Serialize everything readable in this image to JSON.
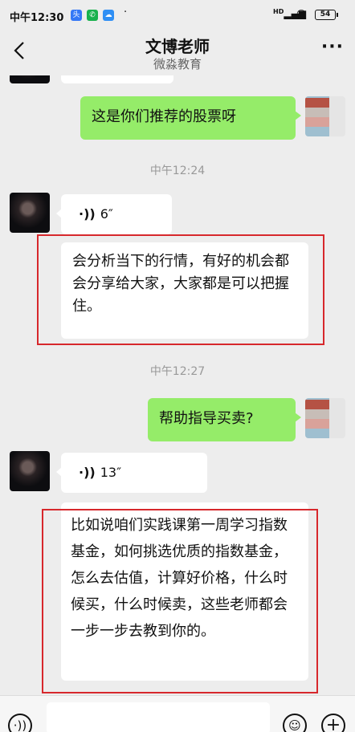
{
  "status_bar": {
    "time": "中午12:30",
    "app_icons": [
      {
        "icon": "toutiao-app-icon",
        "glyph": "头",
        "color": "#3478f6"
      },
      {
        "icon": "phone-app-icon",
        "glyph": "✆",
        "color": "#18b14d"
      },
      {
        "icon": "cloud-app-icon",
        "glyph": "☁",
        "color": "#2f8ff5"
      }
    ],
    "dot": "·",
    "signal": "HD",
    "battery": "54"
  },
  "header": {
    "back_icon": "back-chevron-icon",
    "title": "文博老师",
    "subtitle": "微淼教育",
    "more_label": "···"
  },
  "messages": {
    "m1_text": "这是你们推荐的股票呀",
    "t1": "中午12:24",
    "v1_duration": "6″",
    "m2_text": "会分析当下的行情，有好的机会都会分享给大家，大家都是可以把握住。",
    "t2": "中午12:27",
    "m3_text": "帮助指导买卖?",
    "v2_duration": "13″",
    "m4_text": "比如说咱们实践课第一周学习指数基金，如何挑选优质的指数基金，怎么去估值，计算好价格，什么时候买，什么时候卖，这些老师都会一步一步去教到你的。"
  },
  "input_bar": {
    "voice_icon": "voice-mode-icon",
    "emoji_icon": "emoji-icon",
    "plus_icon": "plus-icon"
  },
  "colors": {
    "background": "#ededed",
    "sent_bubble": "#95ec69",
    "received_bubble": "#ffffff",
    "highlight_box": "#d7282c"
  }
}
